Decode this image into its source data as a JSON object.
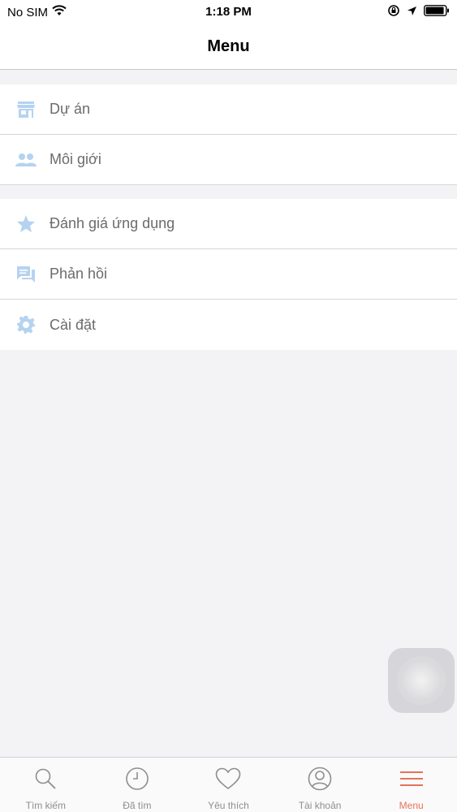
{
  "status_bar": {
    "carrier": "No SIM",
    "time": "1:18 PM"
  },
  "nav": {
    "title": "Menu"
  },
  "sections": [
    {
      "items": [
        {
          "label": "Dự án",
          "icon": "store-icon"
        },
        {
          "label": "Môi giới",
          "icon": "people-icon"
        }
      ]
    },
    {
      "items": [
        {
          "label": "Đánh giá ứng dụng",
          "icon": "star-icon"
        },
        {
          "label": "Phản hồi",
          "icon": "feedback-icon"
        },
        {
          "label": "Cài đặt",
          "icon": "gear-icon"
        }
      ]
    }
  ],
  "tabs": [
    {
      "label": "Tìm kiếm",
      "icon": "search-icon",
      "active": false
    },
    {
      "label": "Đã tìm",
      "icon": "clock-icon",
      "active": false
    },
    {
      "label": "Yêu thích",
      "icon": "heart-icon",
      "active": false
    },
    {
      "label": "Tài khoản",
      "icon": "user-icon",
      "active": false
    },
    {
      "label": "Menu",
      "icon": "menu-icon",
      "active": true
    }
  ],
  "colors": {
    "menu_icon": "#b5d3f0",
    "active_tab": "#e5735a",
    "inactive_tab": "#8e8e93",
    "background": "#f3f3f5"
  }
}
